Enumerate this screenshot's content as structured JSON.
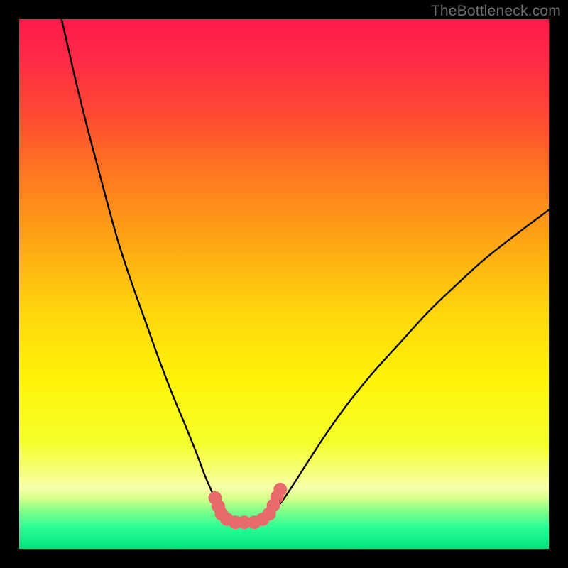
{
  "watermark": "TheBottleneck.com",
  "chart_data": {
    "type": "line",
    "title": "",
    "xlabel": "",
    "ylabel": "",
    "xlim": [
      0,
      100
    ],
    "ylim": [
      0,
      100
    ],
    "gradient_stops": [
      {
        "offset": 0.0,
        "color": "#ff1a4d"
      },
      {
        "offset": 0.08,
        "color": "#ff2b46"
      },
      {
        "offset": 0.18,
        "color": "#ff4a33"
      },
      {
        "offset": 0.3,
        "color": "#ff7a1f"
      },
      {
        "offset": 0.42,
        "color": "#ffa615"
      },
      {
        "offset": 0.55,
        "color": "#ffd50d"
      },
      {
        "offset": 0.68,
        "color": "#fff308"
      },
      {
        "offset": 0.8,
        "color": "#f4ff2b"
      },
      {
        "offset": 0.885,
        "color": "#f7ffa8"
      },
      {
        "offset": 0.905,
        "color": "#d6ff8a"
      },
      {
        "offset": 0.93,
        "color": "#7bff8a"
      },
      {
        "offset": 0.96,
        "color": "#2bff95"
      },
      {
        "offset": 1.0,
        "color": "#03e07e"
      }
    ],
    "series": [
      {
        "name": "curve-left",
        "color": "#000000",
        "x": [
          8.0,
          9.5,
          11.0,
          13.0,
          15.0,
          17.0,
          19.0,
          21.5,
          24.0,
          26.5,
          29.0,
          31.5,
          33.5,
          35.0,
          36.3,
          37.3,
          38.1
        ],
        "y": [
          100.0,
          93.5,
          87.0,
          79.0,
          71.5,
          64.0,
          57.0,
          49.5,
          42.5,
          35.5,
          29.0,
          23.0,
          18.0,
          14.0,
          11.0,
          9.0,
          7.6
        ]
      },
      {
        "name": "curve-right",
        "color": "#000000",
        "x": [
          48.5,
          50.0,
          52.0,
          55.0,
          58.5,
          62.5,
          67.0,
          72.0,
          77.0,
          82.5,
          88.0,
          94.0,
          100.0
        ],
        "y": [
          7.6,
          9.5,
          12.5,
          17.2,
          22.5,
          28.0,
          33.5,
          39.0,
          44.5,
          49.8,
          54.8,
          59.5,
          64.0
        ]
      },
      {
        "name": "marker-dots",
        "color": "#e86b6b",
        "x": [
          37.0,
          37.6,
          38.2,
          39.2,
          40.8,
          42.5,
          44.4,
          46.0,
          47.2,
          48.0,
          48.7,
          49.3
        ],
        "y": [
          9.6,
          8.0,
          6.6,
          5.6,
          5.0,
          5.0,
          5.0,
          5.6,
          6.6,
          8.2,
          9.8,
          11.2
        ]
      }
    ]
  }
}
